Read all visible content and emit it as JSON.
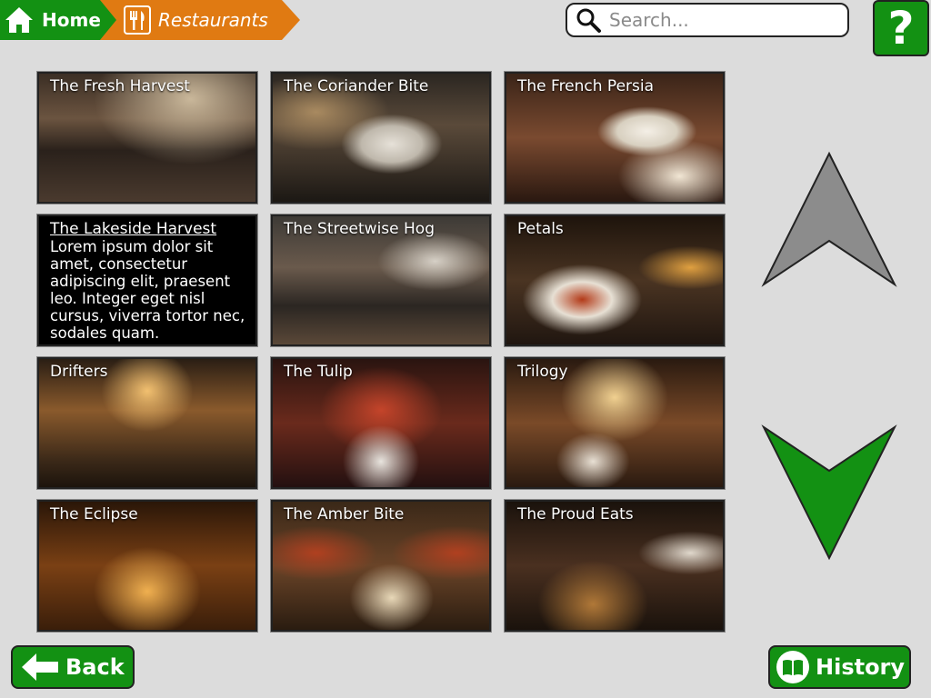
{
  "breadcrumb": {
    "home_label": "Home",
    "current_label": "Restaurants"
  },
  "search": {
    "placeholder": "Search..."
  },
  "help": {
    "label": "?"
  },
  "restaurants": [
    {
      "name": "The Fresh Harvest"
    },
    {
      "name": "The Coriander Bite"
    },
    {
      "name": "The French Persia"
    },
    {
      "name": "The Lakeside Harvest",
      "description": "Lorem ipsum dolor sit amet, consectetur adipiscing elit, praesent leo. Integer eget nisl cursus, viverra tortor nec, sodales quam.",
      "selected": true
    },
    {
      "name": "The Streetwise Hog"
    },
    {
      "name": "Petals"
    },
    {
      "name": "Drifters"
    },
    {
      "name": "The Tulip"
    },
    {
      "name": "Trilogy"
    },
    {
      "name": "The Eclipse"
    },
    {
      "name": "The Amber Bite"
    },
    {
      "name": "The Proud Eats"
    }
  ],
  "navigation": {
    "back_label": "Back",
    "history_label": "History"
  },
  "colors": {
    "green": "#139113",
    "orange": "#e07a12",
    "arrow_up_gray": "#8c8c8c"
  }
}
